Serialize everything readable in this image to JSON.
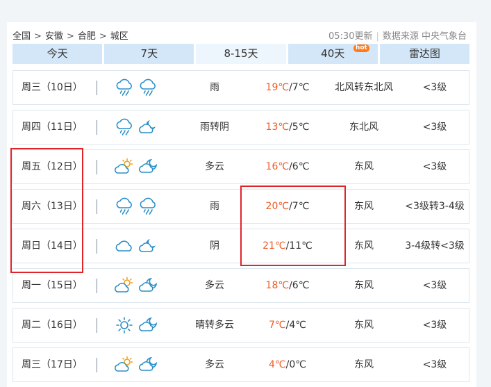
{
  "breadcrumb": {
    "items": [
      "全国",
      "安徽",
      "合肥",
      "城区"
    ],
    "separator": ">"
  },
  "meta": {
    "update_time": "05:30更新",
    "source": "数据来源 中央气象台"
  },
  "tabs": [
    {
      "label": "今天",
      "active": false
    },
    {
      "label": "7天",
      "active": false
    },
    {
      "label": "8-15天",
      "active": true
    },
    {
      "label": "40天",
      "active": false,
      "badge": "hot"
    },
    {
      "label": "雷达图",
      "active": false
    }
  ],
  "forecast": [
    {
      "day": "周三（10日）",
      "icons": [
        "rain-cloud-icon",
        "rain-cloud-icon"
      ],
      "condition": "雨",
      "high": "19℃",
      "low": "/7℃",
      "wind": "北风转东北风",
      "level": "<3级"
    },
    {
      "day": "周四（11日）",
      "icons": [
        "rain-cloud-icon",
        "cloudy-night-icon"
      ],
      "condition": "雨转阴",
      "high": "13℃",
      "low": "/5℃",
      "wind": "东北风",
      "level": "<3级"
    },
    {
      "day": "周五（12日）",
      "icons": [
        "partly-cloudy-day-icon",
        "partly-cloudy-night-icon"
      ],
      "condition": "多云",
      "high": "16℃",
      "low": "/6℃",
      "wind": "东风",
      "level": "<3级"
    },
    {
      "day": "周六（13日）",
      "icons": [
        "rain-cloud-icon",
        "rain-cloud-icon"
      ],
      "condition": "雨",
      "high": "20℃",
      "low": "/7℃",
      "wind": "东风",
      "level": "<3级转3-4级"
    },
    {
      "day": "周日（14日）",
      "icons": [
        "cloud-icon",
        "cloudy-night-icon"
      ],
      "condition": "阴",
      "high": "21℃",
      "low": "/11℃",
      "wind": "东风",
      "level": "3-4级转<3级"
    },
    {
      "day": "周一（15日）",
      "icons": [
        "partly-cloudy-day-icon",
        "partly-cloudy-night-icon"
      ],
      "condition": "多云",
      "high": "18℃",
      "low": "/6℃",
      "wind": "东风",
      "level": "<3级"
    },
    {
      "day": "周二（16日）",
      "icons": [
        "sun-icon",
        "partly-cloudy-night-icon"
      ],
      "condition": "晴转多云",
      "high": "7℃",
      "low": "/4℃",
      "wind": "东风",
      "level": "<3级"
    },
    {
      "day": "周三（17日）",
      "icons": [
        "partly-cloudy-day-icon",
        "partly-cloudy-night-icon"
      ],
      "condition": "多云",
      "high": "4℃",
      "low": "/0℃",
      "wind": "东风",
      "level": "<3级"
    }
  ],
  "colors": {
    "high_temp": "#f05a23",
    "icon_stroke": "#2a8fc7",
    "highlight": "#e0242a",
    "tab_bg": "#d4e7f8"
  }
}
